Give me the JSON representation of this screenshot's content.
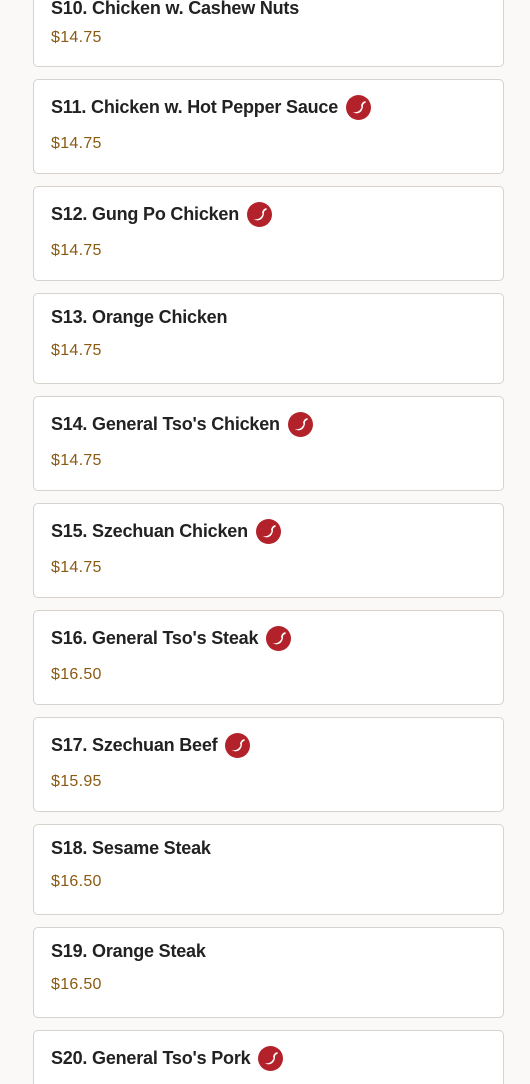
{
  "spicy_icon_color": "#b3222a",
  "menu_items": [
    {
      "name": "S10. Chicken w. Cashew Nuts",
      "price": "$14.75",
      "spicy": false
    },
    {
      "name": "S11. Chicken w. Hot Pepper Sauce",
      "price": "$14.75",
      "spicy": true
    },
    {
      "name": "S12. Gung Po Chicken",
      "price": "$14.75",
      "spicy": true
    },
    {
      "name": "S13. Orange Chicken",
      "price": "$14.75",
      "spicy": false
    },
    {
      "name": "S14. General Tso's Chicken",
      "price": "$14.75",
      "spicy": true
    },
    {
      "name": "S15. Szechuan Chicken",
      "price": "$14.75",
      "spicy": true
    },
    {
      "name": "S16. General Tso's Steak",
      "price": "$16.50",
      "spicy": true
    },
    {
      "name": "S17. Szechuan Beef",
      "price": "$15.95",
      "spicy": true
    },
    {
      "name": "S18. Sesame Steak",
      "price": "$16.50",
      "spicy": false
    },
    {
      "name": "S19. Orange Steak",
      "price": "$16.50",
      "spicy": false
    },
    {
      "name": "S20. General Tso's Pork",
      "price": "",
      "spicy": true
    }
  ]
}
